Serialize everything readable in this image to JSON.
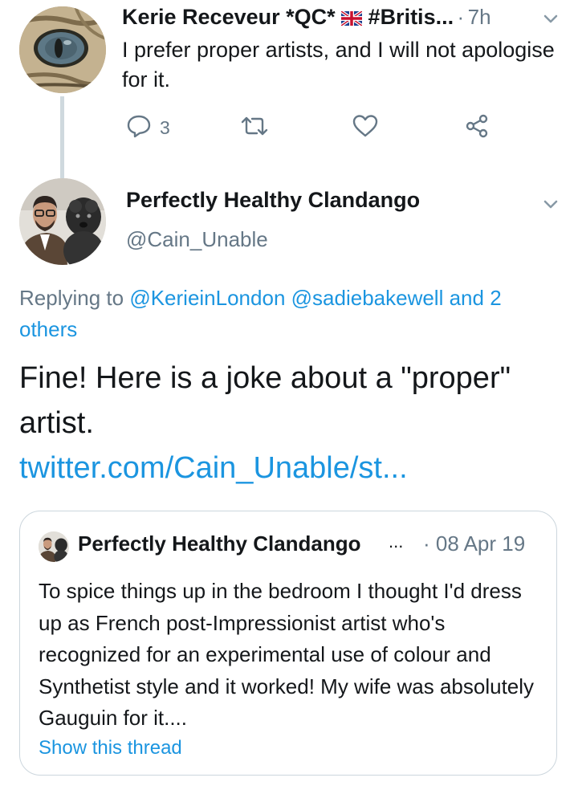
{
  "tweet1": {
    "author_name": "Kerie Receveur *QC*",
    "flag": "🇬🇧",
    "hashtag_truncated": "#Britis...",
    "separator": "·",
    "time": "7h",
    "text": "I prefer proper artists, and I will not apologise for it.",
    "reply_count": "3",
    "icons": {
      "reply": "reply-icon",
      "retweet": "retweet-icon",
      "like": "like-icon",
      "share": "share-icon",
      "menu": "chevron-down-icon"
    }
  },
  "tweet2": {
    "author_name": "Perfectly Healthy Clandango",
    "handle": "@Cain_Unable",
    "replying_prefix": "Replying to",
    "replying_to": [
      "@KerieinLondon",
      "@sadiebakewell"
    ],
    "replying_joiner": "and",
    "replying_others": "2 others",
    "text": "Fine! Here is a joke about a \"proper\" artist.",
    "link": "twitter.com/Cain_Unable/st..."
  },
  "quoted": {
    "author_name": "Perfectly Healthy Clandango",
    "ellipsis": "...",
    "date": "· 08 Apr 19",
    "text": "To spice things up in the bedroom I thought I'd dress up as French post-Impressionist artist who's recognized for an experimental use of colour and Synthetist style and it worked! My wife was absolutely Gauguin for it....",
    "show_thread": "Show this thread"
  },
  "colors": {
    "text": "#14171a",
    "secondary": "#657786",
    "link": "#1b95e0",
    "border": "#ccd6dd",
    "thread_line": "#cfd9de"
  }
}
